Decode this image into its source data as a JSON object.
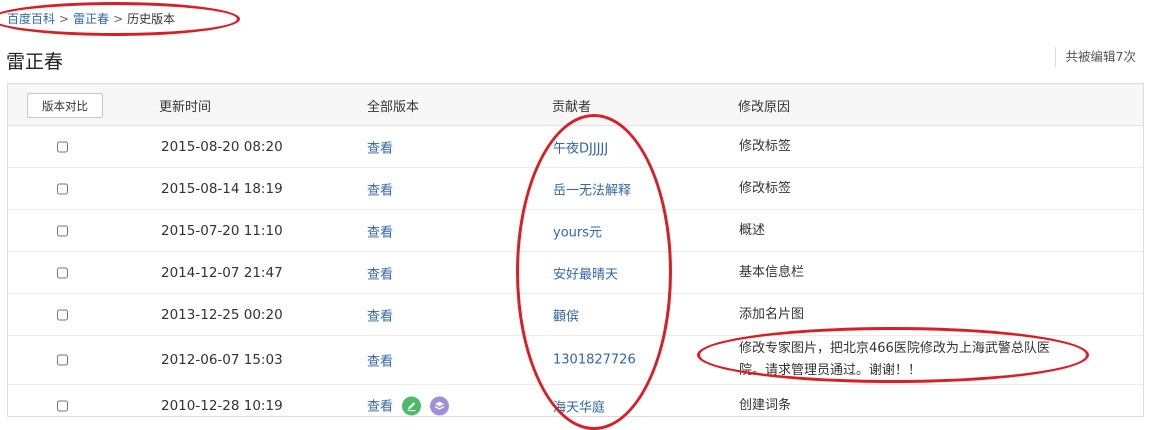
{
  "breadcrumb": {
    "items": [
      "百度百科",
      "雷正春",
      "历史版本"
    ],
    "separator": ">"
  },
  "page_title": "雷正春",
  "edit_count": "共被编辑7次",
  "table": {
    "compare_button": "版本对比",
    "headers": {
      "time": "更新时间",
      "version": "全部版本",
      "author": "贡献者",
      "reason": "修改原因"
    },
    "rows": [
      {
        "time": "2015-08-20 08:20",
        "view": "查看",
        "author": "午夜DJJJJJ",
        "reason": "修改标签"
      },
      {
        "time": "2015-08-14 18:19",
        "view": "查看",
        "author": "岳一无法解释",
        "reason": "修改标签"
      },
      {
        "time": "2015-07-20 11:10",
        "view": "查看",
        "author": "yours元",
        "reason": "概述"
      },
      {
        "time": "2014-12-07 21:47",
        "view": "查看",
        "author": "安好最晴天",
        "reason": "基本信息栏"
      },
      {
        "time": "2013-12-25 00:20",
        "view": "查看",
        "author": "顴傧",
        "reason": "添加名片图"
      },
      {
        "time": "2012-06-07 15:03",
        "view": "查看",
        "author": "1301827726",
        "reason": "修改专家图片，把北京466医院修改为上海武警总队医院。请求管理员通过。谢谢！！"
      },
      {
        "time": "2010-12-28 10:19",
        "view": "查看",
        "author": "海天华庭",
        "reason": "创建词条"
      }
    ]
  },
  "icons": {
    "edit_badge": "pencil-icon",
    "layers_badge": "layers-icon"
  },
  "colors": {
    "link": "#3366aa",
    "annotation": "#d81f26",
    "badge_green": "#4cba6b",
    "badge_purple": "#9f8ed8"
  }
}
